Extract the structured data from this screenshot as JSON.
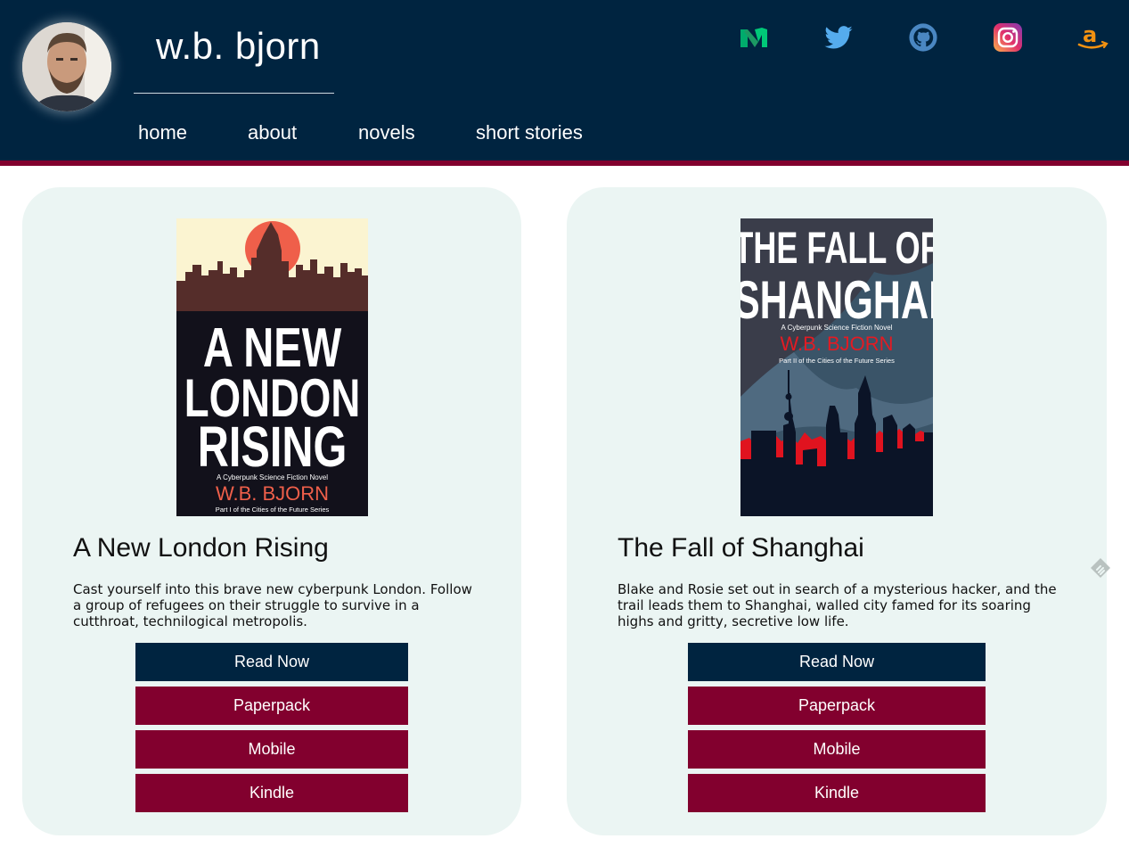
{
  "header": {
    "site_title": "w.b. bjorn",
    "nav": [
      "home",
      "about",
      "novels",
      "short stories"
    ],
    "social_icons": [
      "medium-icon",
      "twitter-icon",
      "github-icon",
      "instagram-icon",
      "amazon-icon"
    ]
  },
  "books": [
    {
      "title": "A New London Rising",
      "description": "Cast yourself into this brave new cyberpunk London. Follow a group of refugees on their struggle to survive in a cutthroat, technilogical metropolis.",
      "cover": {
        "title_lines": [
          "A NEW",
          "LONDON",
          "RISING"
        ],
        "tagline": "A Cyberpunk Science Fiction Novel",
        "author": "W.B. BJORN",
        "series": "Part I of the Cities of the Future Series"
      },
      "buttons": [
        "Read Now",
        "Paperpack",
        "Mobile",
        "Kindle"
      ]
    },
    {
      "title": "The Fall of Shanghai",
      "description": "Blake and Rosie set out in search of a mysterious hacker, and the trail leads them to Shanghai, walled city famed for its soaring highs and gritty, secretive low life.",
      "cover": {
        "title_lines": [
          "THE FALL OF",
          "SHANGHAI"
        ],
        "tagline": "A Cyberpunk Science Fiction Novel",
        "author": "W.B. BJORN",
        "series": "Part II of the Cities of the Future Series"
      },
      "buttons": [
        "Read Now",
        "Paperpack",
        "Mobile",
        "Kindle"
      ]
    }
  ],
  "colors": {
    "header_bg": "#002440",
    "accent": "#82002e",
    "card_bg": "#ebf5f3"
  }
}
